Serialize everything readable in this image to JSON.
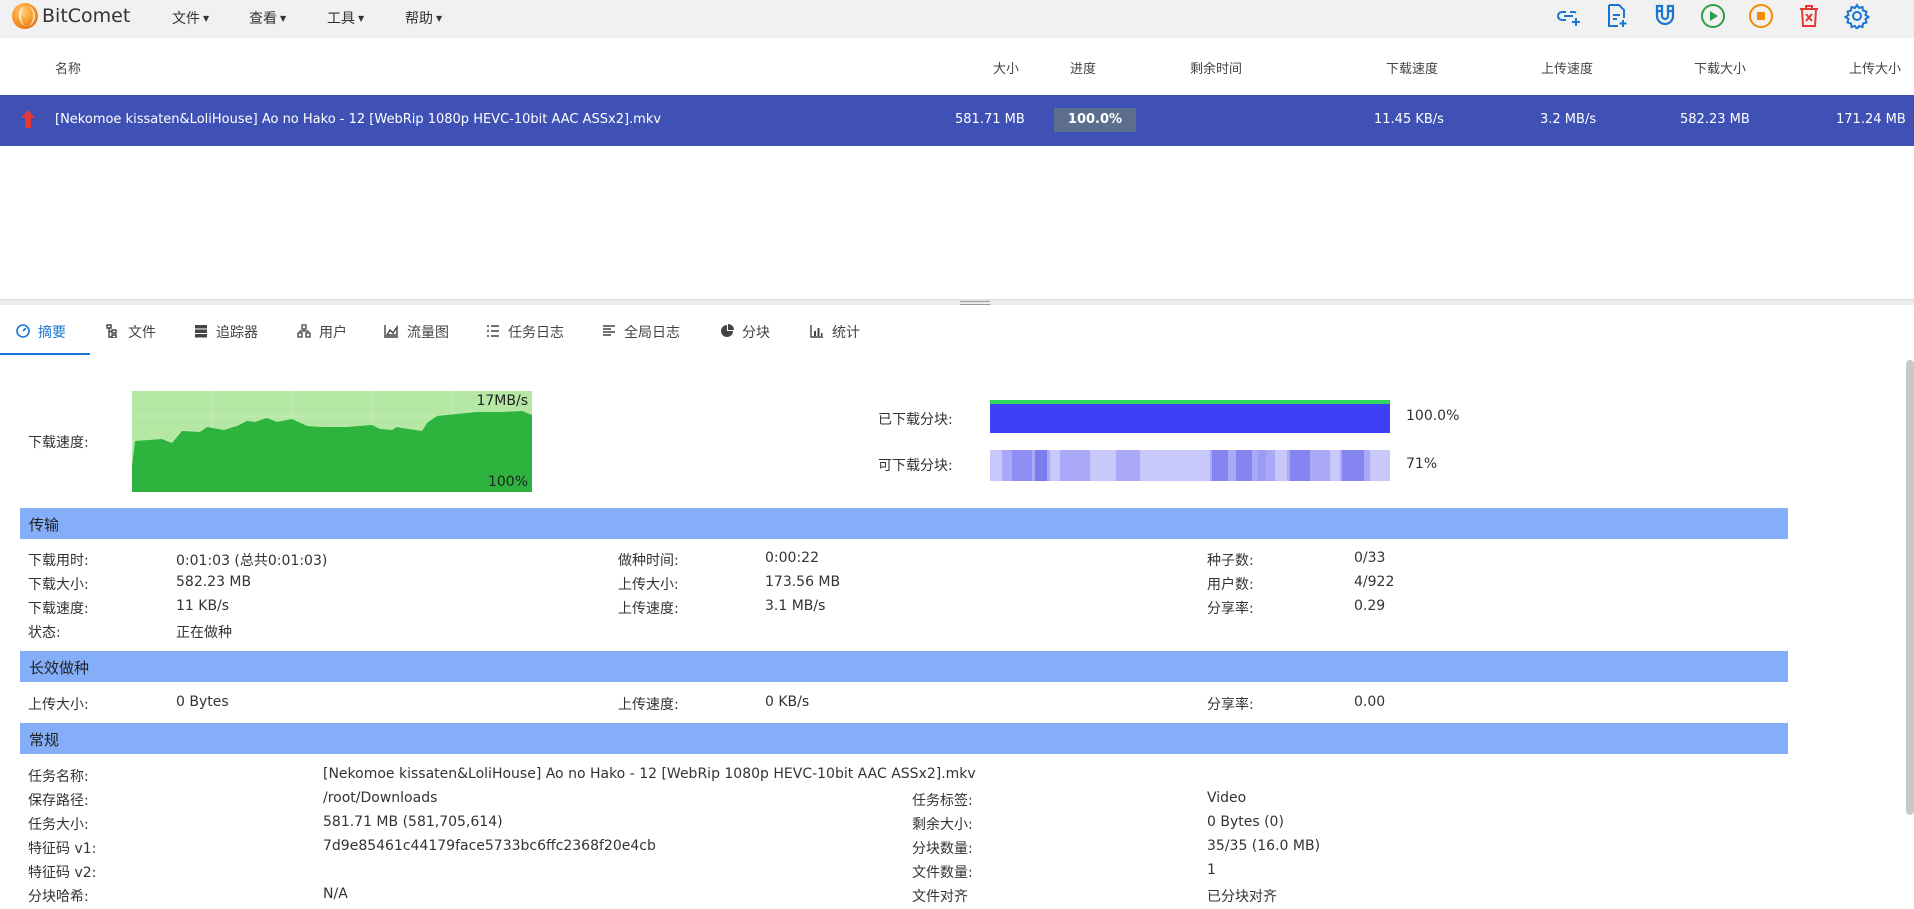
{
  "app": {
    "name": "BitComet"
  },
  "menu": [
    {
      "label": "文件"
    },
    {
      "label": "查看"
    },
    {
      "label": "工具"
    },
    {
      "label": "帮助"
    }
  ],
  "toolbar_icons": [
    "add-link-icon",
    "add-torrent-file-icon",
    "magnet-icon",
    "start-icon",
    "stop-icon",
    "delete-icon",
    "settings-icon"
  ],
  "columns": {
    "name": "名称",
    "size": "大小",
    "progress": "进度",
    "remaining": "剩余时间",
    "down_speed": "下载速度",
    "up_speed": "上传速度",
    "downloaded": "下载大小",
    "uploaded": "上传大小"
  },
  "task": {
    "name": "[Nekomoe kissaten&LoliHouse] Ao no Hako - 12 [WebRip 1080p HEVC-10bit AAC ASSx2].mkv",
    "size": "581.71 MB",
    "progress": "100.0%",
    "remaining": "",
    "down_speed": "11.45 KB/s",
    "up_speed": "3.2 MB/s",
    "downloaded": "582.23 MB",
    "uploaded": "171.24 MB",
    "status_color": "#e53935"
  },
  "tabs": [
    {
      "label": "摘要",
      "active": true
    },
    {
      "label": "文件"
    },
    {
      "label": "追踪器"
    },
    {
      "label": "用户"
    },
    {
      "label": "流量图"
    },
    {
      "label": "任务日志"
    },
    {
      "label": "全局日志"
    },
    {
      "label": "分块"
    },
    {
      "label": "统计"
    }
  ],
  "summary": {
    "speed_label": "下载速度:",
    "graph_max": "17MB/s",
    "graph_pct": "100%",
    "downloaded_blocks_label": "已下载分块:",
    "downloaded_blocks_pct": "100.0%",
    "available_blocks_label": "可下载分块:",
    "available_blocks_pct": "71%"
  },
  "transfer": {
    "title": "传输",
    "dl_time_label": "下载用时:",
    "dl_time": "0:01:03 (总共0:01:03)",
    "dl_size_label": "下载大小:",
    "dl_size": "582.23 MB",
    "dl_speed_label": "下载速度:",
    "dl_speed": "11 KB/s",
    "state_label": "状态:",
    "state": "正在做种",
    "seed_time_label": "做种时间:",
    "seed_time": "0:00:22",
    "ul_size_label": "上传大小:",
    "ul_size": "173.56 MB",
    "ul_speed_label": "上传速度:",
    "ul_speed": "3.1 MB/s",
    "seeds_label": "种子数:",
    "seeds": "0/33",
    "peers_label": "用户数:",
    "peers": "4/922",
    "ratio_label": "分享率:",
    "ratio": "0.29"
  },
  "longterm": {
    "title": "长效做种",
    "ul_size_label": "上传大小:",
    "ul_size": "0 Bytes",
    "ul_speed_label": "上传速度:",
    "ul_speed": "0 KB/s",
    "ratio_label": "分享率:",
    "ratio": "0.00"
  },
  "general": {
    "title": "常规",
    "task_name_label": "任务名称:",
    "task_name": "[Nekomoe kissaten&LoliHouse] Ao no Hako - 12 [WebRip 1080p HEVC-10bit AAC ASSx2].mkv",
    "save_path_label": "保存路径:",
    "save_path": "/root/Downloads",
    "task_size_label": "任务大小:",
    "task_size": "581.71 MB (581,705,614)",
    "hash_v1_label": "特征码 v1:",
    "hash_v1": "7d9e85461c44179face5733bc6ffc2368f20e4cb",
    "hash_v2_label": "特征码 v2:",
    "hash_v2": "",
    "piece_hash_label": "分块哈希:",
    "piece_hash": "N/A",
    "tag_label": "任务标签:",
    "tag": "Video",
    "remaining_label": "剩余大小:",
    "remaining": "0 Bytes (0)",
    "pieces_label": "分块数量:",
    "pieces": "35/35 (16.0 MB)",
    "files_label": "文件数量:",
    "files": "1",
    "align_label": "文件对齐",
    "align": "已分块对齐"
  },
  "colors": {
    "accent": "#1976d2",
    "selected_row": "#3f51b5",
    "section_bar": "#84aef8",
    "graph_fill": "#2db33e",
    "graph_bg": "#b4e8a4",
    "block_done": "#3f3ff5"
  }
}
